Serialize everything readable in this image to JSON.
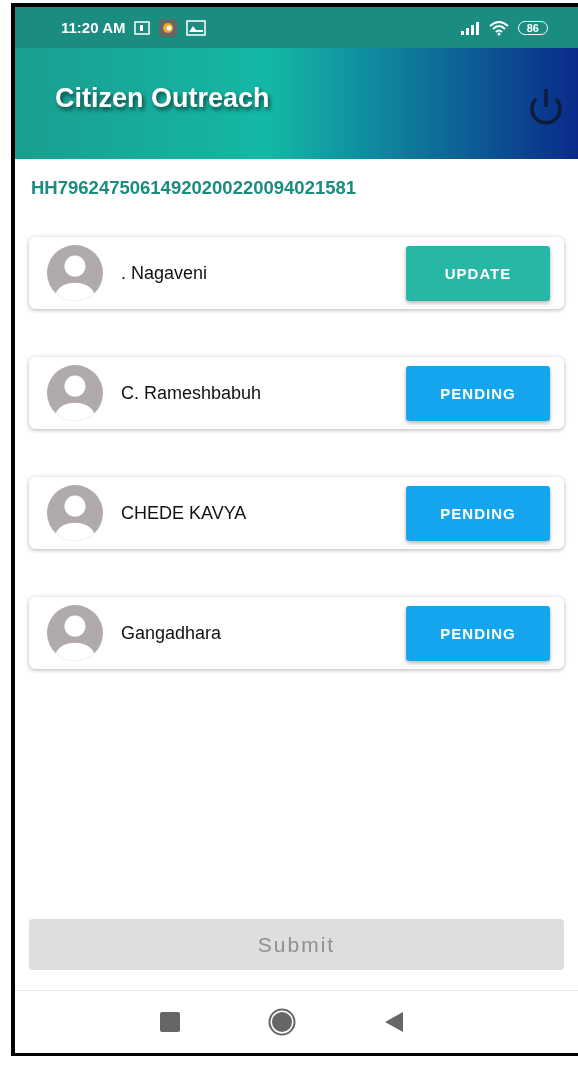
{
  "status_bar": {
    "time": "11:20 AM",
    "battery": "86"
  },
  "app_bar": {
    "title": "Citizen Outreach"
  },
  "household_id": "HH79624750614920200220094021581",
  "members": [
    {
      "name": ". Nagaveni",
      "action": "UPDATE",
      "kind": "update"
    },
    {
      "name": "C. Rameshbabuh",
      "action": "PENDING",
      "kind": "pending"
    },
    {
      "name": "CHEDE KAVYA",
      "action": "PENDING",
      "kind": "pending"
    },
    {
      "name": "Gangadhara",
      "action": "PENDING",
      "kind": "pending"
    }
  ],
  "submit": {
    "label": "Submit",
    "disabled": true
  }
}
